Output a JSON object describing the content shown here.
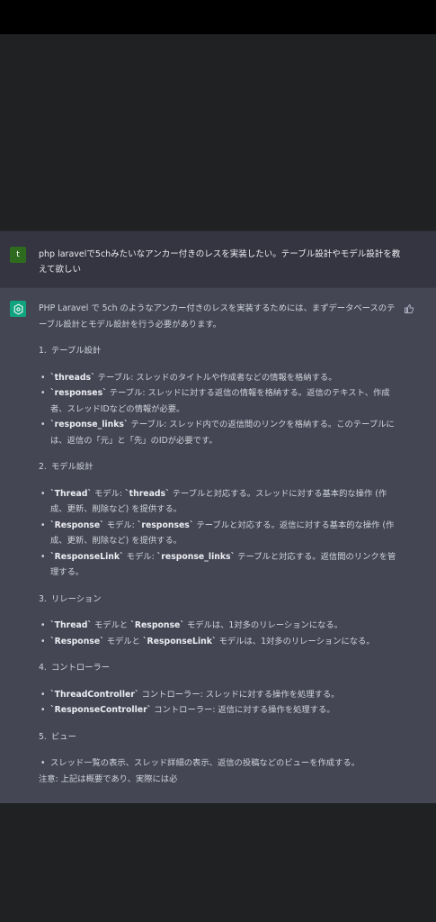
{
  "user_message": {
    "avatar_letter": "t",
    "text": "php laravelで5chみたいなアンカー付きのレスを実装したい。テーブル設計やモデル設計を教えて欲しい"
  },
  "assistant_message": {
    "intro": "PHP Laravel で 5ch のようなアンカー付きのレスを実装するためには、まずデータベースのテーブル設計とモデル設計を行う必要があります。",
    "sections": [
      {
        "num": "1.",
        "title": "テーブル設計",
        "items": [
          {
            "code": "`threads`",
            "text": " テーブル: スレッドのタイトルや作成者などの情報を格納する。"
          },
          {
            "code": "`responses`",
            "text": " テーブル: スレッドに対する返信の情報を格納する。返信のテキスト、作成者、スレッドIDなどの情報が必要。"
          },
          {
            "code": "`response_links`",
            "text": " テーブル: スレッド内での返信間のリンクを格納する。このテーブルには、返信の「元」と「先」のIDが必要です。"
          }
        ]
      },
      {
        "num": "2.",
        "title": "モデル設計",
        "items": [
          {
            "code": "`Thread`",
            "mid": " モデル: ",
            "code2": "`threads`",
            "text": " テーブルと対応する。スレッドに対する基本的な操作 (作成、更新、削除など) を提供する。"
          },
          {
            "code": "`Response`",
            "mid": " モデル: ",
            "code2": "`responses`",
            "text": " テーブルと対応する。返信に対する基本的な操作 (作成、更新、削除など) を提供する。"
          },
          {
            "code": "`ResponseLink`",
            "mid": " モデル: ",
            "code2": "`response_links`",
            "text": " テーブルと対応する。返信間のリンクを管理する。"
          }
        ]
      },
      {
        "num": "3.",
        "title": "リレーション",
        "items": [
          {
            "code": "`Thread`",
            "mid": " モデルと ",
            "code2": "`Response`",
            "text": " モデルは、1対多のリレーションになる。"
          },
          {
            "code": "`Response`",
            "mid": " モデルと ",
            "code2": "`ResponseLink`",
            "text": " モデルは、1対多のリレーションになる。"
          }
        ]
      },
      {
        "num": "4.",
        "title": "コントローラー",
        "items": [
          {
            "code": "`ThreadController`",
            "text": " コントローラー: スレッドに対する操作を処理する。"
          },
          {
            "code": "`ResponseController`",
            "text": " コントローラー: 返信に対する操作を処理する。"
          }
        ]
      },
      {
        "num": "5.",
        "title": "ビュー",
        "items": [
          {
            "text": "スレッド一覧の表示、スレッド詳細の表示、返信の投稿などのビューを作成する。"
          }
        ]
      }
    ],
    "note": "注意: 上記は概要であり、実際には必"
  }
}
